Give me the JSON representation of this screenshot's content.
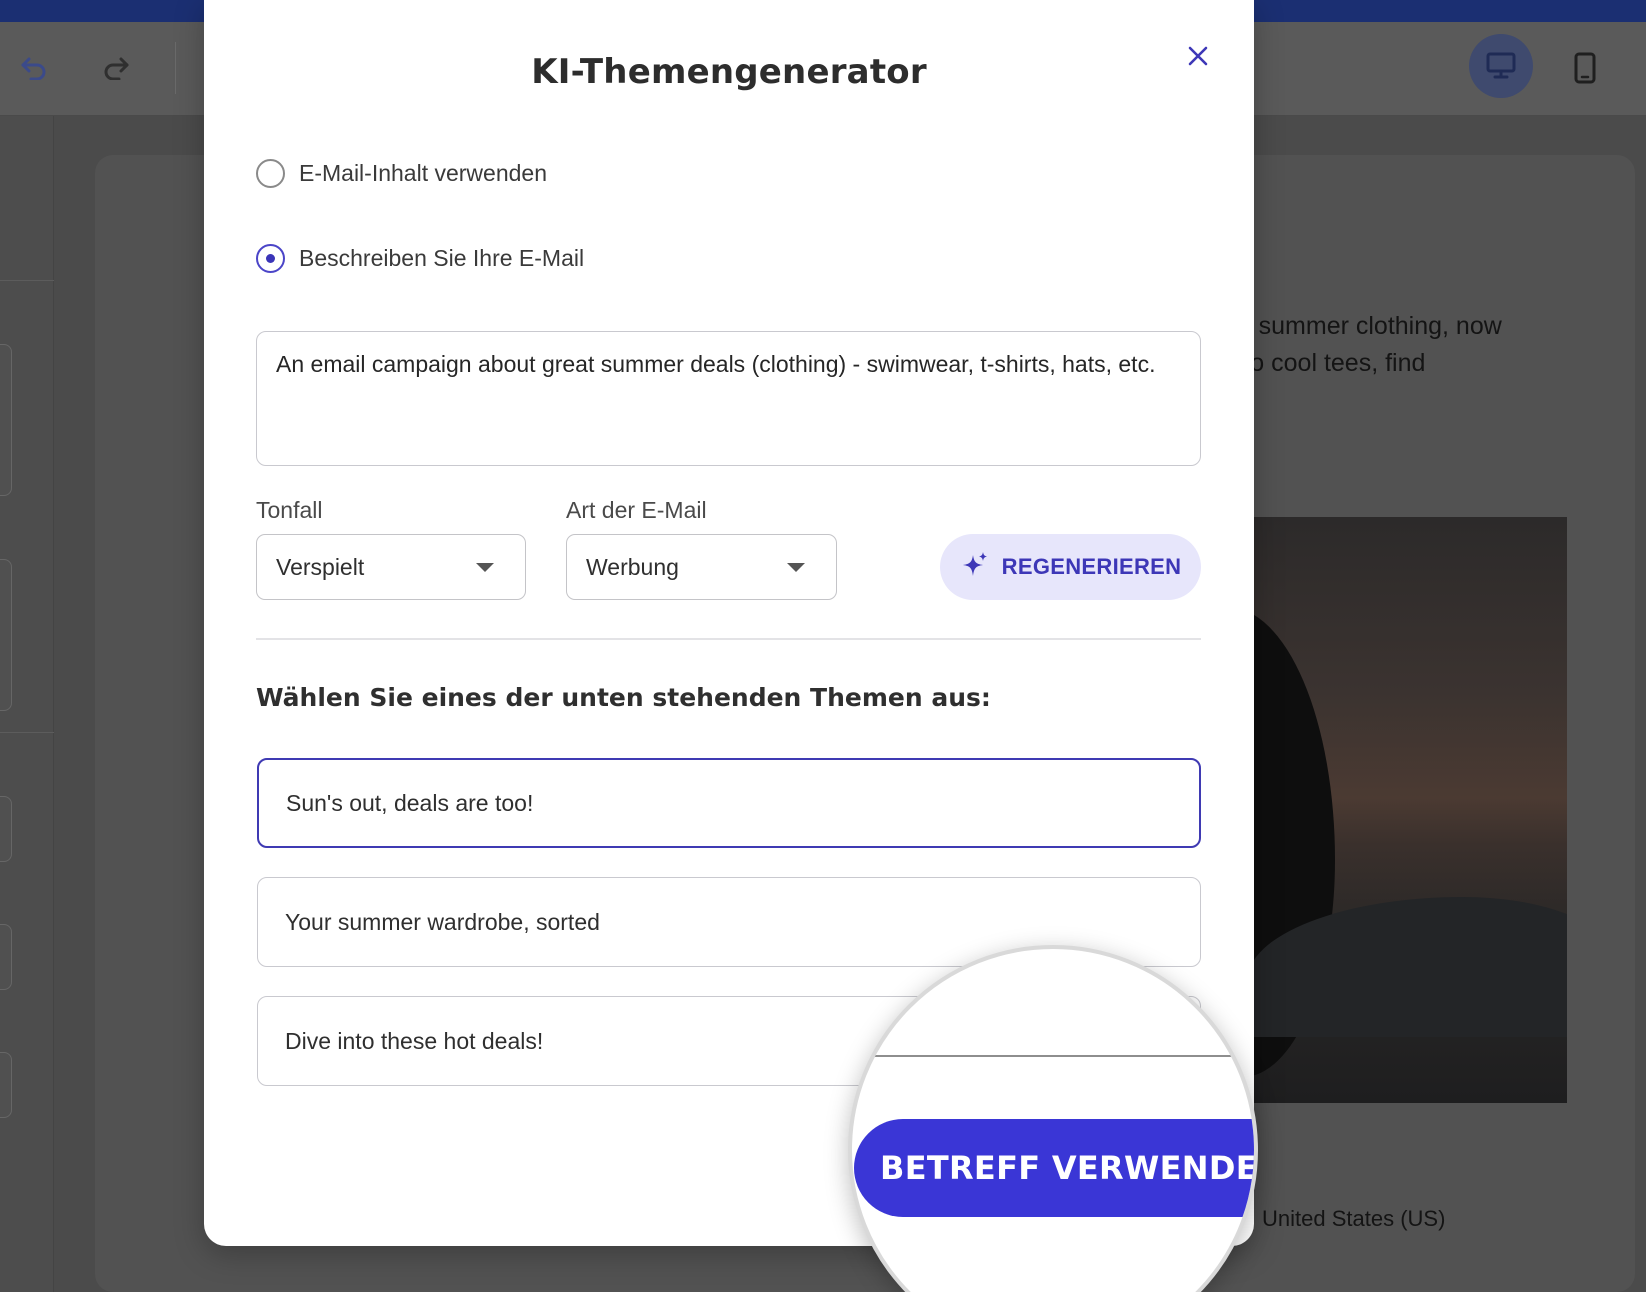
{
  "background": {
    "body_text_line1": "e of summer clothing, now",
    "body_text_line2": "es to cool tees, find",
    "country": "United States (US)"
  },
  "modal": {
    "title": "KI-Themengenerator",
    "source_options": [
      {
        "label": "E-Mail-Inhalt verwenden",
        "checked": false
      },
      {
        "label": "Beschreiben Sie Ihre E-Mail",
        "checked": true
      }
    ],
    "description_value": "An email campaign about great summer deals (clothing) - swimwear, t-shirts, hats, etc.",
    "tone": {
      "label": "Tonfall",
      "value": "Verspielt"
    },
    "email_type": {
      "label": "Art der E-Mail",
      "value": "Werbung"
    },
    "regenerate_label": "REGENERIEREN",
    "section_title": "Wählen Sie eines der unten stehenden Themen aus:",
    "subjects": [
      {
        "text": "Sun's out, deals are too!",
        "selected": true
      },
      {
        "text": "Your summer wardrobe, sorted",
        "selected": false
      },
      {
        "text": "Dive into these hot deals!",
        "selected": false
      }
    ],
    "use_subject_label": "BETREFF VERWENDEN"
  },
  "colors": {
    "accent": "#3a36d6",
    "accent_dark": "#3d37b7",
    "accent_soft": "#e7e6fb",
    "topbar": "#1b2f72"
  },
  "icons": {
    "undo": "undo-icon",
    "redo": "redo-icon",
    "desktop": "desktop-icon",
    "mobile": "mobile-icon",
    "close": "close-icon",
    "sparkle": "sparkle-icon",
    "caret": "chevron-down-icon"
  }
}
